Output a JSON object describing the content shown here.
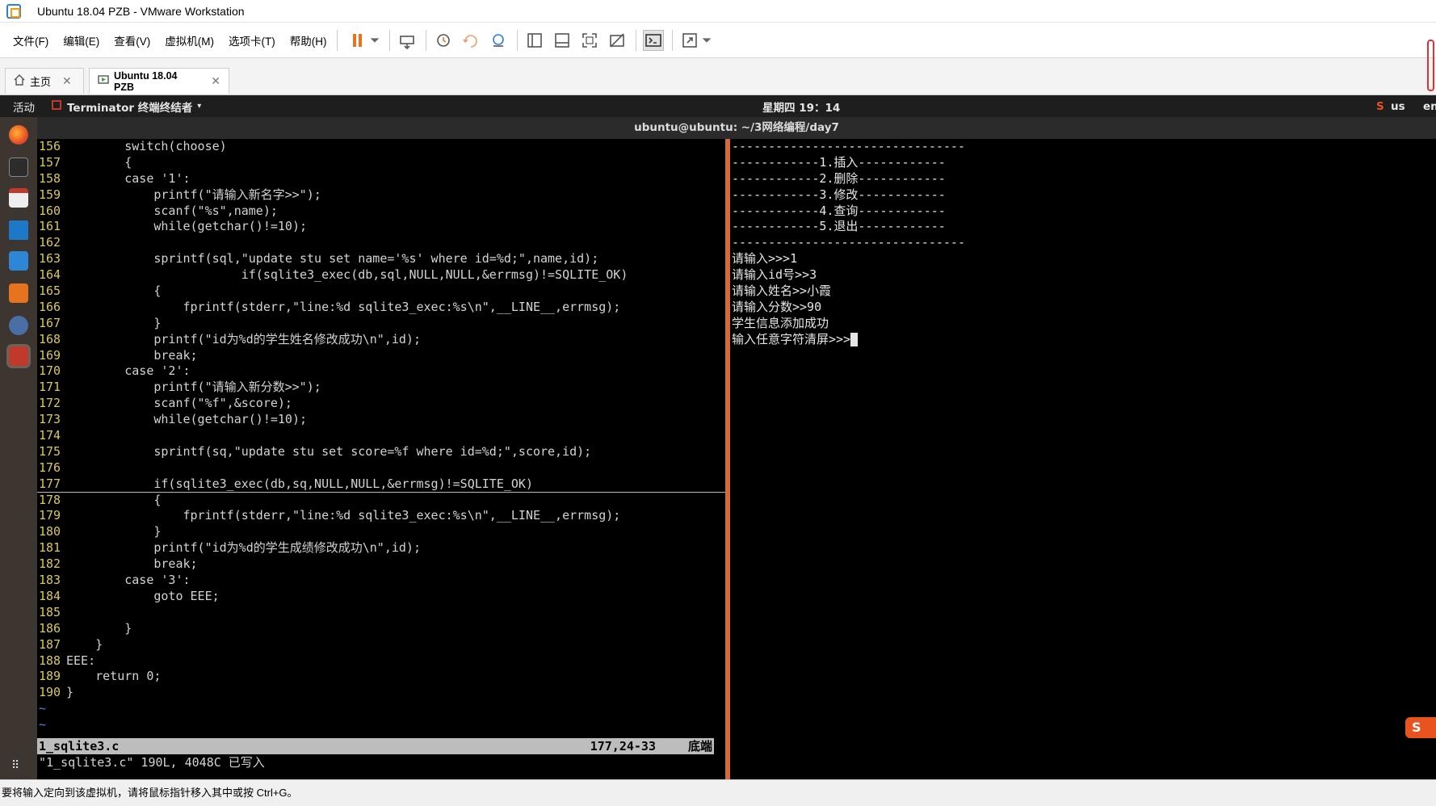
{
  "window": {
    "title": "Ubuntu 18.04 PZB - VMware Workstation"
  },
  "menu": [
    "文件(F)",
    "编辑(E)",
    "查看(V)",
    "虚拟机(M)",
    "选项卡(T)",
    "帮助(H)"
  ],
  "tabs": [
    {
      "label": "主页"
    },
    {
      "label": "Ubuntu 18.04 PZB"
    }
  ],
  "gnome": {
    "activities": "活动",
    "app_menu": "Terminator 终端终结者",
    "clock": "星期四 19：14",
    "input_method": "us",
    "lang": "en"
  },
  "terminal": {
    "title": "ubuntu@ubuntu: ~/3网络编程/day7",
    "code_lines": [
      {
        "n": "156",
        "t": "        switch(choose)"
      },
      {
        "n": "157",
        "t": "        {"
      },
      {
        "n": "158",
        "t": "        case '1':"
      },
      {
        "n": "159",
        "t": "            printf(\"请输入新名字>>\");"
      },
      {
        "n": "160",
        "t": "            scanf(\"%s\",name);"
      },
      {
        "n": "161",
        "t": "            while(getchar()!=10);"
      },
      {
        "n": "162",
        "t": ""
      },
      {
        "n": "163",
        "t": "            sprintf(sql,\"update stu set name='%s' where id=%d;\",name,id);"
      },
      {
        "n": "164",
        "t": "                        if(sqlite3_exec(db,sql,NULL,NULL,&errmsg)!=SQLITE_OK)"
      },
      {
        "n": "165",
        "t": "            {"
      },
      {
        "n": "166",
        "t": "                fprintf(stderr,\"line:%d sqlite3_exec:%s\\n\",__LINE__,errmsg);"
      },
      {
        "n": "167",
        "t": "            }"
      },
      {
        "n": "168",
        "t": "            printf(\"id为%d的学生姓名修改成功\\n\",id);"
      },
      {
        "n": "169",
        "t": "            break;"
      },
      {
        "n": "170",
        "t": "        case '2':"
      },
      {
        "n": "171",
        "t": "            printf(\"请输入新分数>>\");"
      },
      {
        "n": "172",
        "t": "            scanf(\"%f\",&score);"
      },
      {
        "n": "173",
        "t": "            while(getchar()!=10);"
      },
      {
        "n": "174",
        "t": ""
      },
      {
        "n": "175",
        "t": "            sprintf(sq,\"update stu set score=%f where id=%d;\",score,id);"
      },
      {
        "n": "176",
        "t": ""
      },
      {
        "n": "177",
        "t": "            if(sqlite3_exec(db,sq,NULL,NULL,&errmsg)!=SQLITE_OK)"
      },
      {
        "n": "178",
        "t": "            {"
      },
      {
        "n": "179",
        "t": "                fprintf(stderr,\"line:%d sqlite3_exec:%s\\n\",__LINE__,errmsg);"
      },
      {
        "n": "180",
        "t": "            }"
      },
      {
        "n": "181",
        "t": "            printf(\"id为%d的学生成绩修改成功\\n\",id);"
      },
      {
        "n": "182",
        "t": "            break;"
      },
      {
        "n": "183",
        "t": "        case '3':"
      },
      {
        "n": "184",
        "t": "            goto EEE;"
      },
      {
        "n": "185",
        "t": ""
      },
      {
        "n": "186",
        "t": "        }"
      },
      {
        "n": "187",
        "t": "    }"
      },
      {
        "n": "188",
        "t": "EEE:"
      },
      {
        "n": "189",
        "t": "    return 0;"
      },
      {
        "n": "190",
        "t": "}"
      }
    ],
    "tildes": [
      "~",
      "~"
    ],
    "status_file": "1_sqlite3.c",
    "status_pos": "177,24-33",
    "status_scroll": "底端",
    "cmdline": "\"1_sqlite3.c\" 190L, 4048C 已写入",
    "right_lines": [
      "--------------------------------",
      "------------1.插入------------",
      "------------2.删除------------",
      "------------3.修改------------",
      "------------4.查询------------",
      "------------5.退出------------",
      "--------------------------------",
      "请输入>>>1",
      "请输入id号>>3",
      "请输入姓名>>小霞",
      "请输入分数>>90",
      "学生信息添加成功",
      "输入任意字符清屏>>>"
    ]
  },
  "vm_status": "要将输入定向到该虚拟机，请将鼠标指针移入其中或按 Ctrl+G。",
  "colors": {
    "divider": "#d16a3c",
    "line_numbers": "#d9c85b",
    "dock": "#3c3530"
  }
}
